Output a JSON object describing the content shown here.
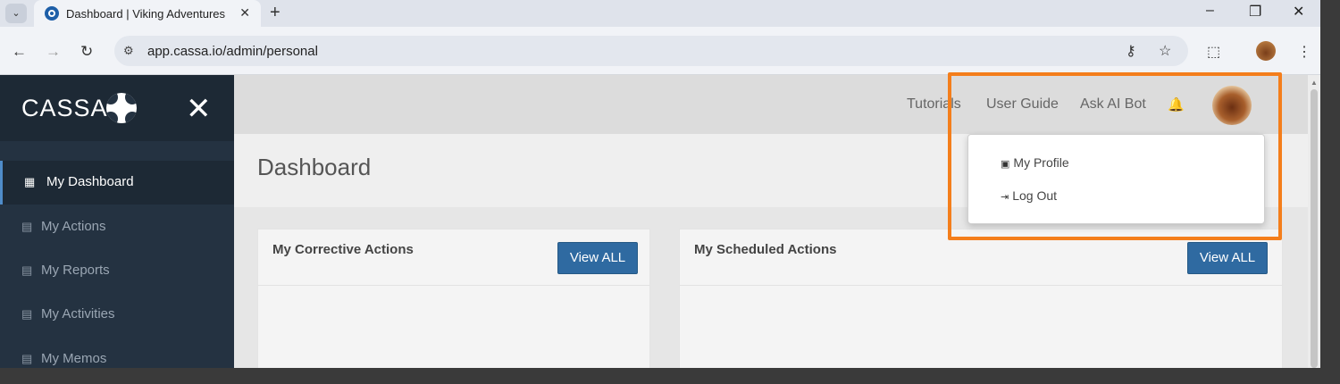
{
  "browser": {
    "tab_title": "Dashboard | Viking Adventures",
    "tab_close": "✕",
    "new_tab": "+",
    "url": "app.cassa.io/admin/personal",
    "window_controls": [
      "–",
      "❐",
      "✕"
    ]
  },
  "sidebar": {
    "brand": "CASSA",
    "close": "✕",
    "items": [
      {
        "label": "My Dashboard",
        "icon": "dashboard-icon",
        "glyph": "▦",
        "active": true
      },
      {
        "label": "My Actions",
        "icon": "calendar-icon",
        "glyph": "▤",
        "active": false
      },
      {
        "label": "My Reports",
        "icon": "report-icon",
        "glyph": "▤",
        "active": false
      },
      {
        "label": "My Activities",
        "icon": "activity-icon",
        "glyph": "▤",
        "active": false
      },
      {
        "label": "My Memos",
        "icon": "memo-icon",
        "glyph": "▤",
        "active": false
      }
    ]
  },
  "topbar": {
    "links": [
      "Tutorials",
      "User Guide",
      "Ask AI Bot"
    ],
    "bell": "🔔"
  },
  "page": {
    "title": "Dashboard"
  },
  "cards": [
    {
      "title": "My Corrective Actions",
      "button": "View ALL"
    },
    {
      "title": "My Scheduled Actions",
      "button": "View ALL"
    }
  ],
  "user_menu": {
    "items": [
      {
        "label": "My Profile",
        "icon": "id-card-icon",
        "glyph": "▣"
      },
      {
        "label": "Log Out",
        "icon": "sign-out-icon",
        "glyph": "⇥"
      }
    ]
  },
  "colors": {
    "sidebar": "#243241",
    "accent_button": "#2f6aa1",
    "highlight": "#f47e1b"
  }
}
